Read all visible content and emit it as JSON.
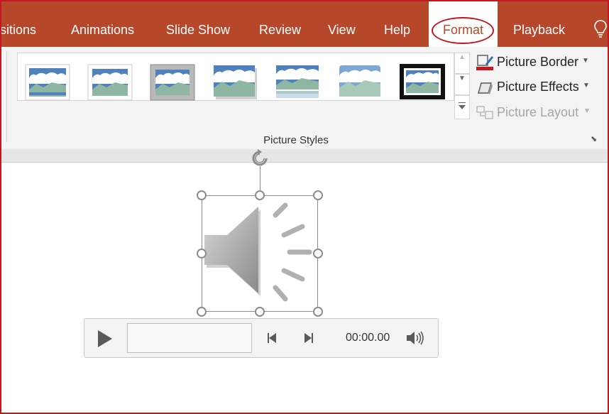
{
  "ribbon_tabs": {
    "transitions": "sitions",
    "animations": "Animations",
    "slide_show": "Slide Show",
    "review": "Review",
    "view": "View",
    "help": "Help",
    "format": "Format",
    "playback": "Playback"
  },
  "picture_styles": {
    "group_label": "Picture Styles",
    "commands": {
      "picture_border": "Picture Border",
      "picture_effects": "Picture Effects",
      "picture_layout": "Picture Layout"
    },
    "picture_layout_disabled": true
  },
  "media_player": {
    "time": "00:00.00"
  },
  "icons": {
    "play": "play-icon",
    "previous": "skip-back-icon",
    "next": "skip-forward-icon",
    "volume": "volume-icon",
    "rotate": "rotate-icon",
    "speaker": "speaker-icon",
    "lightbulb": "lightbulb-icon"
  },
  "colors": {
    "accent": "#b7472a",
    "highlight_oval": "#c0181e",
    "border_underline": "#c0181e"
  }
}
